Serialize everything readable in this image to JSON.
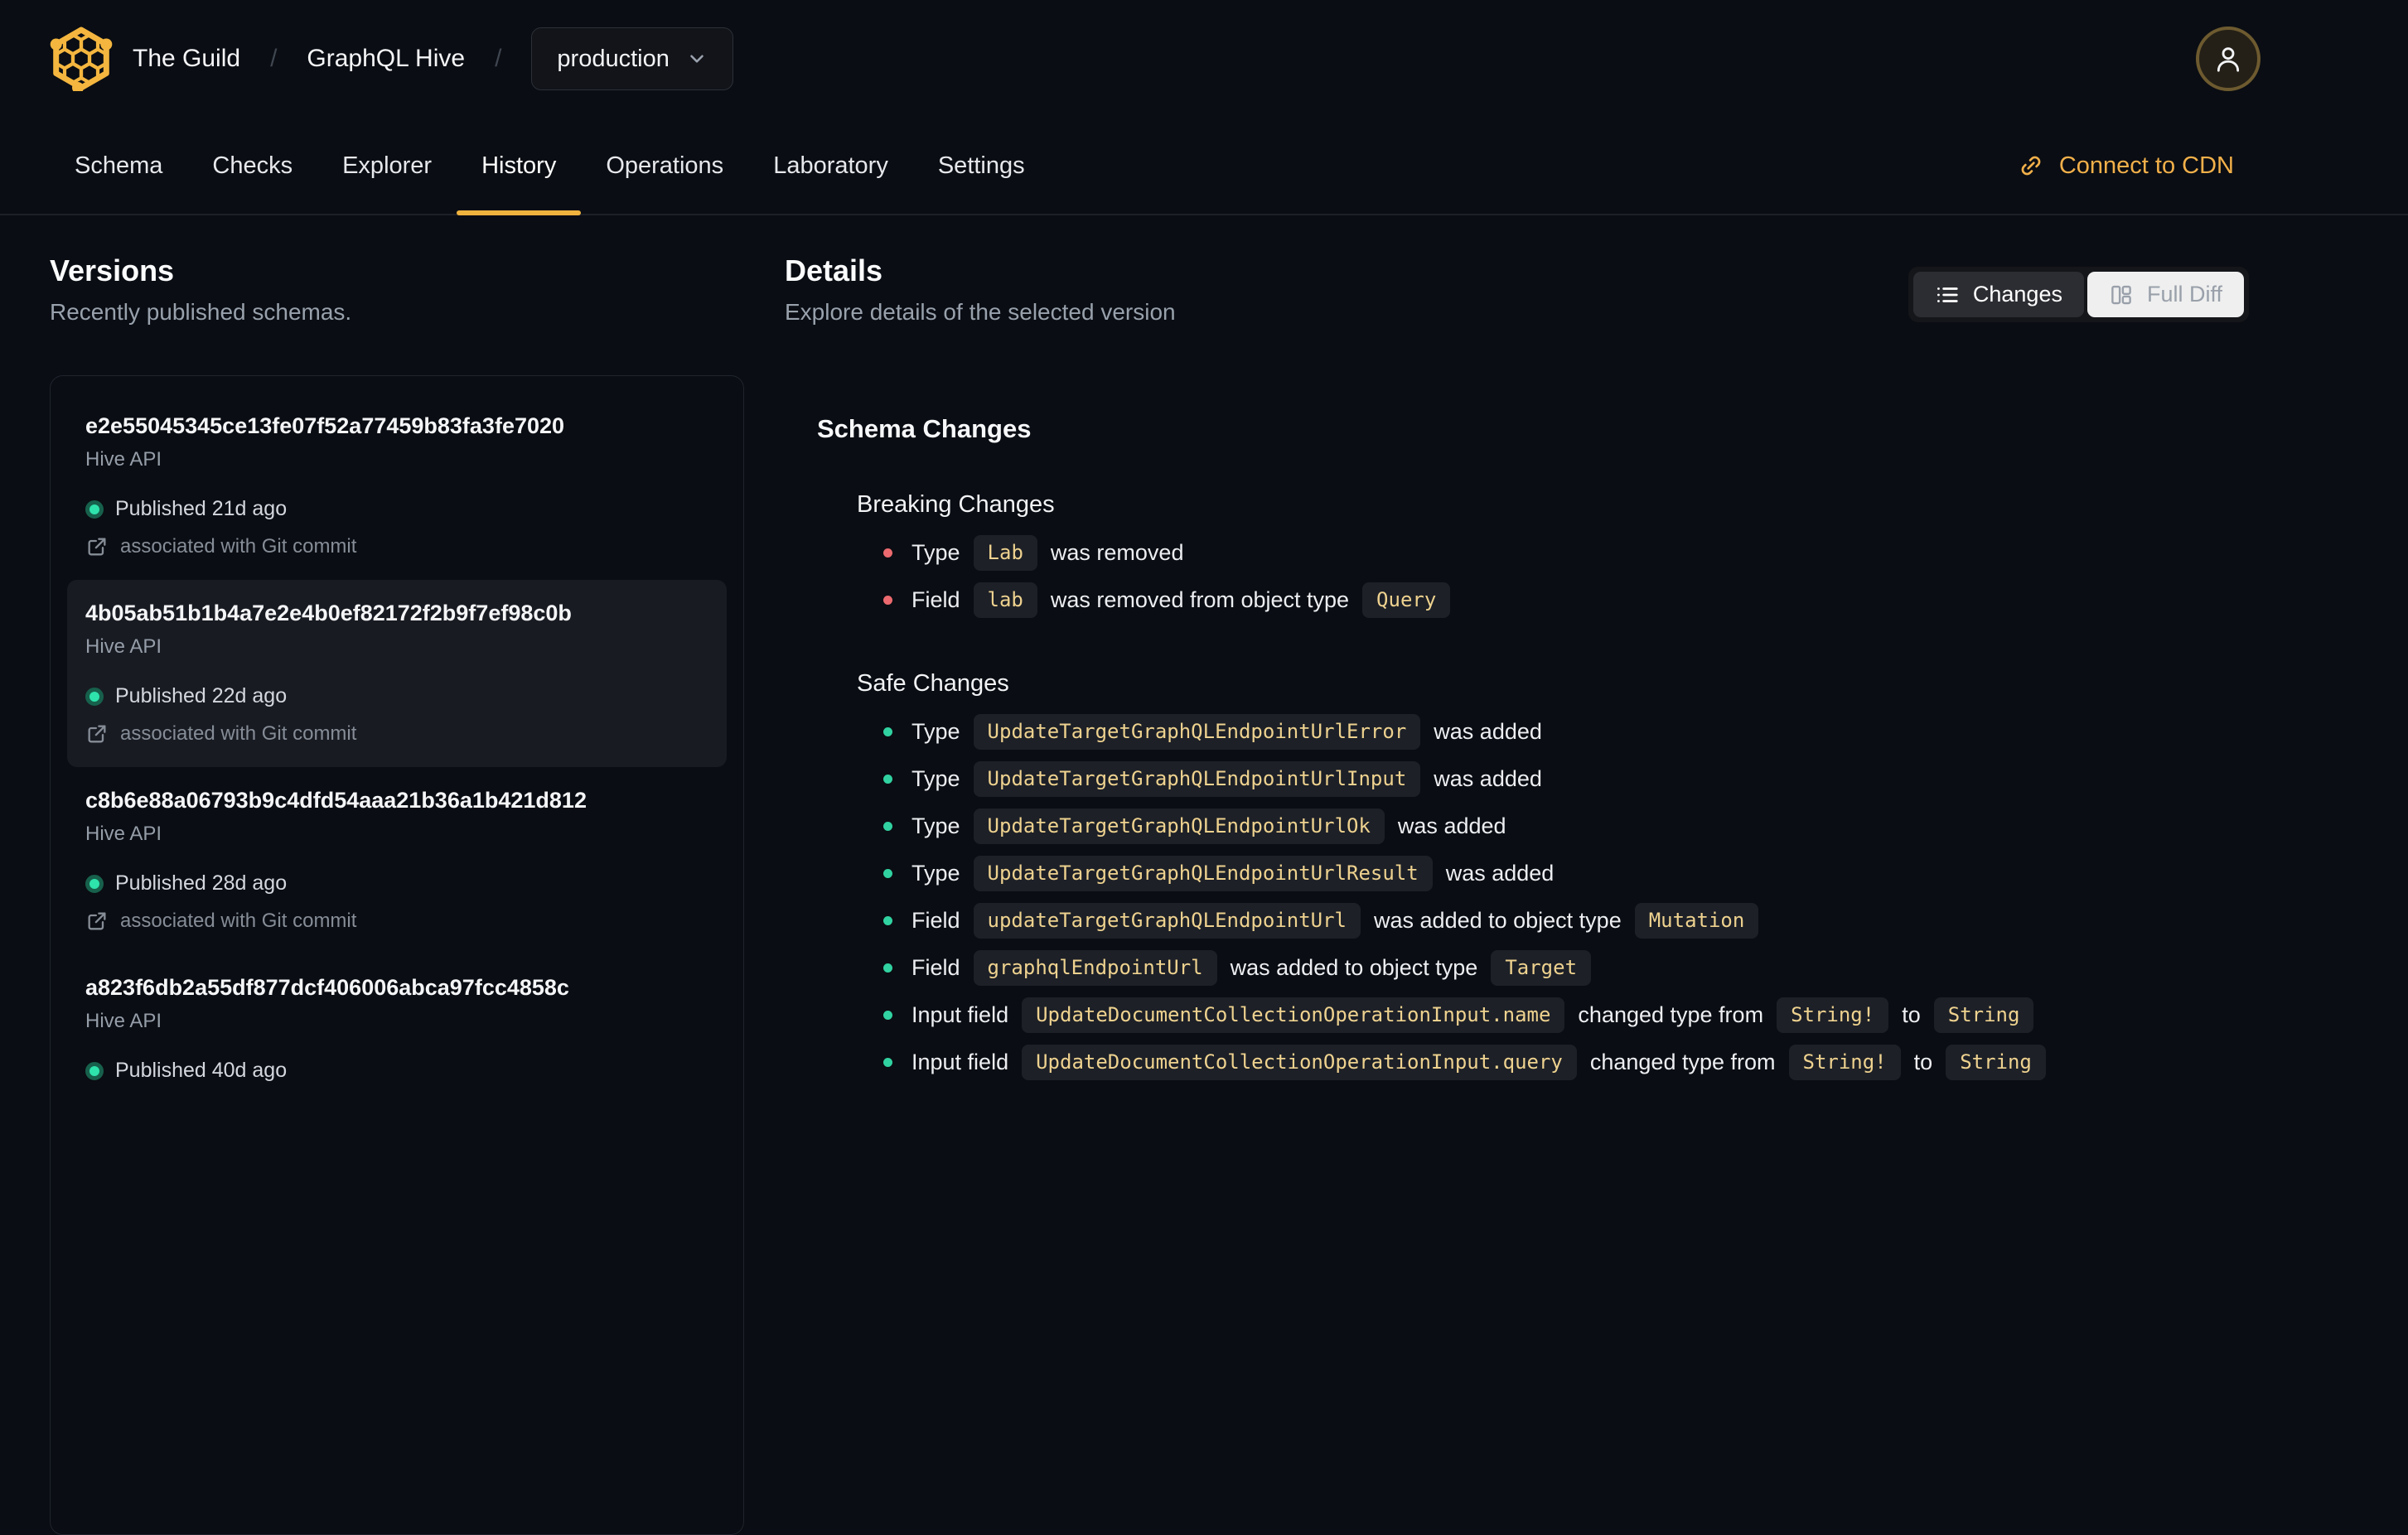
{
  "colors": {
    "accent_amber": "#f0b33e",
    "chip_text": "#eed28f",
    "breaking_bullet": "#ec6a6f",
    "safe_bullet": "#31d2a1",
    "published_dot": "#2ee3ac"
  },
  "header": {
    "breadcrumb": {
      "org": "The Guild",
      "separator": "/",
      "project": "GraphQL Hive"
    },
    "target_select": {
      "value": "production"
    },
    "tabs": [
      "Schema",
      "Checks",
      "Explorer",
      "History",
      "Operations",
      "Laboratory",
      "Settings"
    ],
    "active_tab": "History",
    "cdn_link_label": "Connect to CDN"
  },
  "versions": {
    "title": "Versions",
    "subtitle": "Recently published schemas.",
    "items": [
      {
        "hash": "e2e55045345ce13fe07f52a77459b83fa3fe7020",
        "service": "Hive API",
        "published": "Published 21d ago",
        "git": "associated with Git commit",
        "selected": false
      },
      {
        "hash": "4b05ab51b1b4a7e2e4b0ef82172f2b9f7ef98c0b",
        "service": "Hive API",
        "published": "Published 22d ago",
        "git": "associated with Git commit",
        "selected": true
      },
      {
        "hash": "c8b6e88a06793b9c4dfd54aaa21b36a1b421d812",
        "service": "Hive API",
        "published": "Published 28d ago",
        "git": "associated with Git commit",
        "selected": false
      },
      {
        "hash": "a823f6db2a55df877dcf406006abca97fcc4858c",
        "service": "Hive API",
        "published": "Published 40d ago",
        "selected": false
      }
    ]
  },
  "details": {
    "title": "Details",
    "subtitle": "Explore details of the selected version",
    "view_toggle": {
      "options": [
        {
          "label": "Changes",
          "icon": "list-icon",
          "active": true
        },
        {
          "label": "Full Diff",
          "icon": "columns-icon",
          "active": false
        }
      ]
    },
    "schema_changes": {
      "heading": "Schema Changes",
      "sections": [
        {
          "name": "Breaking Changes",
          "kind": "breaking",
          "items": [
            [
              {
                "text": "Type"
              },
              {
                "code": "Lab"
              },
              {
                "text": "was removed"
              }
            ],
            [
              {
                "text": "Field"
              },
              {
                "code": "lab"
              },
              {
                "text": "was removed from object type"
              },
              {
                "code": "Query"
              }
            ]
          ]
        },
        {
          "name": "Safe Changes",
          "kind": "safe",
          "items": [
            [
              {
                "text": "Type"
              },
              {
                "code": "UpdateTargetGraphQLEndpointUrlError"
              },
              {
                "text": "was added"
              }
            ],
            [
              {
                "text": "Type"
              },
              {
                "code": "UpdateTargetGraphQLEndpointUrlInput"
              },
              {
                "text": "was added"
              }
            ],
            [
              {
                "text": "Type"
              },
              {
                "code": "UpdateTargetGraphQLEndpointUrlOk"
              },
              {
                "text": "was added"
              }
            ],
            [
              {
                "text": "Type"
              },
              {
                "code": "UpdateTargetGraphQLEndpointUrlResult"
              },
              {
                "text": "was added"
              }
            ],
            [
              {
                "text": "Field"
              },
              {
                "code": "updateTargetGraphQLEndpointUrl"
              },
              {
                "text": "was added to object type"
              },
              {
                "code": "Mutation"
              }
            ],
            [
              {
                "text": "Field"
              },
              {
                "code": "graphqlEndpointUrl"
              },
              {
                "text": "was added to object type"
              },
              {
                "code": "Target"
              }
            ],
            [
              {
                "text": "Input field"
              },
              {
                "code": "UpdateDocumentCollectionOperationInput.name"
              },
              {
                "text": "changed type from"
              },
              {
                "code": "String!"
              },
              {
                "text": "to"
              },
              {
                "code": "String"
              }
            ],
            [
              {
                "text": "Input field"
              },
              {
                "code": "UpdateDocumentCollectionOperationInput.query"
              },
              {
                "text": "changed type from"
              },
              {
                "code": "String!"
              },
              {
                "text": "to"
              },
              {
                "code": "String"
              }
            ]
          ]
        }
      ]
    }
  }
}
